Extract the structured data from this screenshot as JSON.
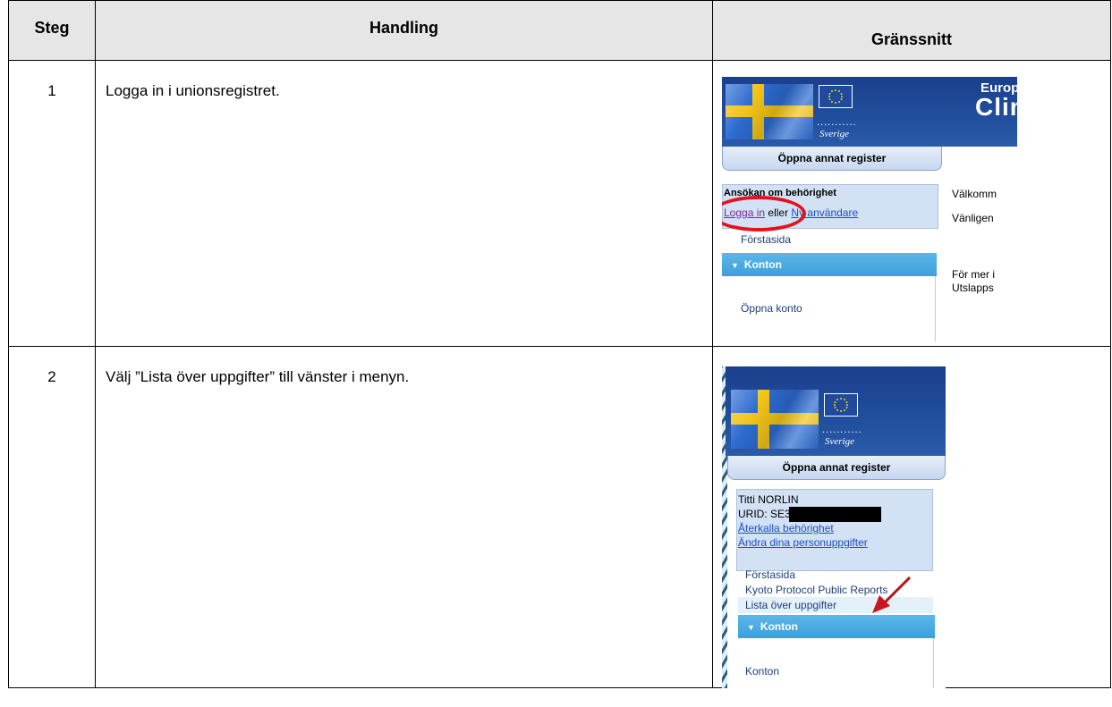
{
  "table": {
    "headers": {
      "step": "Steg",
      "action": "Handling",
      "interface": "Gränssnitt"
    },
    "rows": [
      {
        "step": "1",
        "action": "Logga in i unionsregistret."
      },
      {
        "step": "2",
        "action": "Välj ”Lista över uppgifter” till vänster i menyn."
      }
    ]
  },
  "shot1": {
    "banner_title_1": "Europe",
    "banner_title_2": "Clim",
    "country": "Sverige",
    "dots": "...........",
    "open_register": "Öppna annat register",
    "access_heading": "Ansökan om behörighet",
    "login_link": "Logga in",
    "or_text": "eller",
    "new_user_link": "Ny användare",
    "home": "Förstasida",
    "accounts_header": "Konton",
    "open_account": "Öppna konto",
    "welcome": "Välkomm",
    "please": "Vänligen",
    "more_1": "För mer i",
    "more_2": "Utslapps"
  },
  "shot2": {
    "country": "Sverige",
    "dots": "...........",
    "open_register": "Öppna annat register",
    "user_name": "Titti NORLIN",
    "urid": "URID: SE3",
    "revoke_link": "Återkalla behörighet",
    "edit_link": "Ändra dina personuppgifter",
    "home": "Förstasida",
    "kyoto": "Kyoto Protocol Public Reports",
    "task_list": "Lista över uppgifter",
    "accounts_header": "Konton",
    "accounts": "Konton"
  },
  "colors": {
    "annotation_red": "#e2131d",
    "banner_blue": "#1b3f8c",
    "menu_blue": "#3e9fd9"
  }
}
